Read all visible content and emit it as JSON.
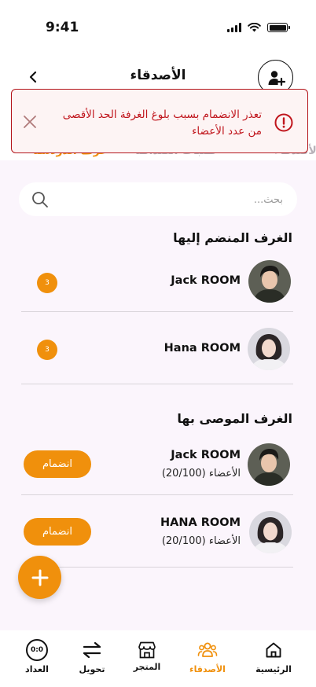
{
  "status_bar": {
    "time": "9:41"
  },
  "header": {
    "title": "الأصدقاء"
  },
  "alert": {
    "message": "تعذر الانضمام بسبب بلوغ الغرفة الحد الأقصى من عدد الأعضاء"
  },
  "tabs": [
    {
      "label": "غرف الدردشة",
      "active": true
    },
    {
      "label": "طلبات الصداقة",
      "active": false
    },
    {
      "label": "قائمة الأصدقاء",
      "active": false
    }
  ],
  "search": {
    "placeholder": "بحث..."
  },
  "joined_rooms": {
    "title": "الغرف المنضم إليها",
    "items": [
      {
        "name": "Jack ROOM",
        "badge": "3"
      },
      {
        "name": "Hana ROOM",
        "badge": "3"
      }
    ]
  },
  "recommended_rooms": {
    "title": "الغرف الموصى بها",
    "items": [
      {
        "name": "Jack ROOM",
        "members": "الأعضاء (20/100)",
        "join_label": "انضمام"
      },
      {
        "name": "HANA ROOM",
        "members": "الأعضاء (20/100)",
        "join_label": "انضمام"
      }
    ]
  },
  "bottom_nav": [
    {
      "label": "الرئيسية",
      "icon": "home-icon",
      "active": false
    },
    {
      "label": "الأصدقاء",
      "icon": "friends-icon",
      "active": true
    },
    {
      "label": "المتجر",
      "icon": "store-icon",
      "active": false
    },
    {
      "label": "تحويل",
      "icon": "transfer-icon",
      "active": false
    },
    {
      "label": "العداد",
      "icon": "counter-icon",
      "active": false
    },
    {
      "counter_text": "0:0"
    }
  ],
  "colors": {
    "accent": "#f0900c",
    "alert": "#c0151c",
    "panel_bg": "#fbf5fc"
  }
}
